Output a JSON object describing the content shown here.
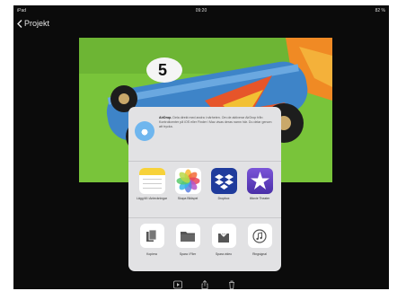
{
  "status": {
    "carrier": "iPad",
    "time": "09:20",
    "battery": "82 %"
  },
  "nav": {
    "back_label": "Projekt"
  },
  "share": {
    "airdrop_title": "AirDrop.",
    "airdrop_text": "Dela direkt med andra i närheten. Om de aktiverar AirDrop från Kontrollcenter på iOS eller Finder i Mac visas deras namn här. Du delar genom att trycka.",
    "apps": [
      {
        "label": "Lägg till i Anteckningar",
        "icon": "notes-icon"
      },
      {
        "label": "Skapa Bildspel",
        "icon": "photos-icon"
      },
      {
        "label": "Dropbox",
        "icon": "dropbox-icon"
      },
      {
        "label": "iMovie Theater",
        "icon": "imovie-icon"
      }
    ],
    "actions": [
      {
        "label": "Kopiera",
        "icon": "copy-icon"
      },
      {
        "label": "Spara i Filer",
        "icon": "folder-icon"
      },
      {
        "label": "Spara video",
        "icon": "save-video-icon"
      },
      {
        "label": "Ringsignal",
        "icon": "ringtone-icon"
      }
    ]
  },
  "colors": {
    "background": "#0b0b0b",
    "sheet": "#e2e2e4",
    "dropbox": "#1f3b9c",
    "imovie": "#5d3fbf"
  }
}
